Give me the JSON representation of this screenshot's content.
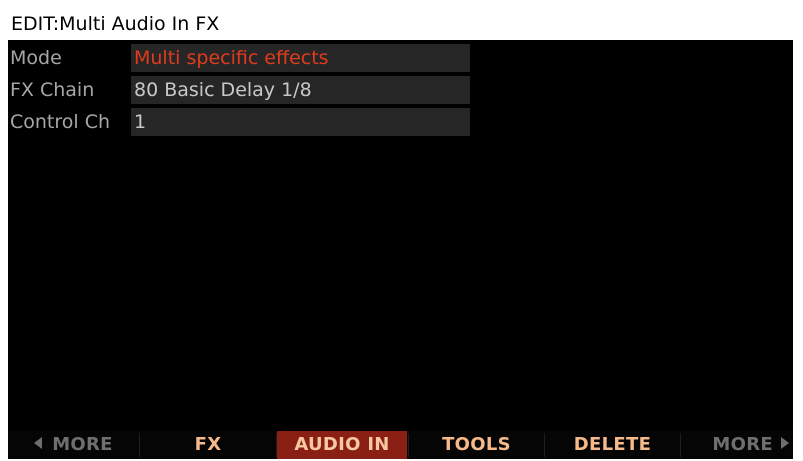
{
  "screen": {
    "title": "EDIT:Multi Audio In FX"
  },
  "params": [
    {
      "label": "Mode",
      "value": "Multi specific effects",
      "selected": true
    },
    {
      "label": "FX Chain",
      "value": "80 Basic Delay 1/8",
      "selected": false
    },
    {
      "label": "Control Ch",
      "value": "1",
      "selected": false
    }
  ],
  "soft_buttons": {
    "more_left": "MORE",
    "fx": "FX",
    "audio_in": "AUDIO IN",
    "tools": "TOOLS",
    "delete": "DELETE",
    "more_right": "MORE"
  },
  "colors": {
    "selected_value": "#e03b1c",
    "active_tab_bg": "#8a1f16",
    "soft_label": "#f5b98a",
    "dim_label": "#6f6f6f"
  }
}
